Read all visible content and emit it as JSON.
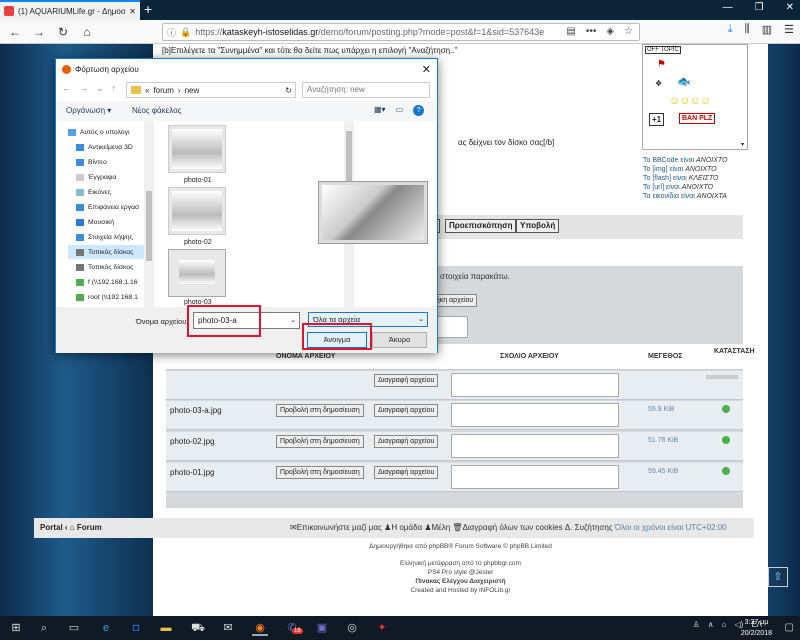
{
  "browser": {
    "tab_title": "(1) AQUARIUMLife.gr - Δημοσ",
    "url_domain": "kataskeyh-istoselidas.gr",
    "url_path": "/demo/forum/posting.php?mode=post&f=1&sid=537643e",
    "url_prefix": "https://"
  },
  "editor": {
    "line1": "[b]Επιλέγετε τα \"Συνημμένα\" και τότε θα δείτε πως υπάρχει η επιλογή \"Αναζήτηση..\"",
    "line2": "ας δείχνει τον δίσκο σας[/b]"
  },
  "smilies": {
    "offtopic": "OFF TOPIC",
    "plus1": "+1",
    "banplz": "BAN PLZ"
  },
  "bbcode_info": [
    {
      "label": "Το BBCode είναι",
      "state": "ΑΝΟΙΧΤΟ"
    },
    {
      "label": "Το [img] είναι",
      "state": "ΑΝΟΙΧΤΟ"
    },
    {
      "label": "Το [flash] είναι",
      "state": "ΚΛΕΙΣΤΟ"
    },
    {
      "label": "Το [url] είναι",
      "state": "ΑΝΟΙΧΤΟ"
    },
    {
      "label": "Τα εικονίδια είναι",
      "state": "ΑΝΟΙΧΤΑ"
    }
  ],
  "submit": {
    "preview_label": "Προεπισκόπηση",
    "submit_label": "Υποβολή"
  },
  "attach": {
    "info_text": "στοιχεία παρακάτω.",
    "add_button": "θήκη αρχείου",
    "col_filename": "ΟΝΟΜΑ ΑΡΧΕΙΟΥ",
    "col_comment": "ΣΧΟΛΙΟ ΑΡΧΕΙΟΥ",
    "col_size": "ΜΕΓΕΘΟΣ",
    "col_status": "ΚΑΤΑΣΤΑΣΗ",
    "delete_label": "Διαγραφή αρχείου",
    "place_label": "Προβολή στη δημοσίευση",
    "rows": [
      {
        "name": "",
        "size": ""
      },
      {
        "name": "photo-03-a.jpg",
        "size": "55.9 KiB"
      },
      {
        "name": "photo-02.jpg",
        "size": "51.76 KiB"
      },
      {
        "name": "photo-01.jpg",
        "size": "59.45 KiB"
      }
    ]
  },
  "footer": {
    "portal": "Portal",
    "forum": "Forum",
    "contact": "Επικοινωνήστε μαζί μας",
    "team": "Η ομάδα",
    "members": "Μέλη",
    "delete_cookies": "Διαγραφή όλων των cookies Δ. Συζήτησης",
    "timezone": "Όλοι οι χρόνοι είναι UTC+02:00"
  },
  "credits": {
    "line1": "Δημιουργήθηκε από phpBB® Forum Software © phpBB Limited",
    "line2": "Ελληνική μετάφραση από το phpbbgr.com",
    "line3": "PS4 Pro style @Jester",
    "line4": "Πίνακας Ελέγχου Διαχειριστή",
    "line5": "Created and Hosted by iNFOLib.gr"
  },
  "dialog": {
    "title": "Φόρτωση αρχείου",
    "path": [
      "«",
      "forum",
      "›",
      "new"
    ],
    "search_placeholder": "Αναζήτηση: new",
    "organize": "Οργάνωση ▾",
    "new_folder": "Νέος φάκελος",
    "nav_items": [
      "Αυτός ο υπολογι",
      "Αντικείμενα 3D",
      "Βίντεο",
      "Έγγραφα",
      "Εικόνες",
      "Επιφάνεια εργασ",
      "Μουσική",
      "Στοιχεία λήψης",
      "Τοπικός δίσκος",
      "Τοπικός δίσκος",
      "f (\\\\192.168.1.16",
      "root (\\\\192.168.1"
    ],
    "files": [
      "photo-01",
      "photo-02",
      "photo-03"
    ],
    "filename_label": "Όνομα αρχείου:",
    "filename_value": "photo-03-a",
    "filetype_value": "Όλα τα αρχεία",
    "open_label": "Άνοιγμα",
    "cancel_label": "Άκυρο"
  },
  "taskbar": {
    "lang": "ΕΛ",
    "time": "3:37 μμ",
    "date": "20/2/2018",
    "badge": "16"
  }
}
